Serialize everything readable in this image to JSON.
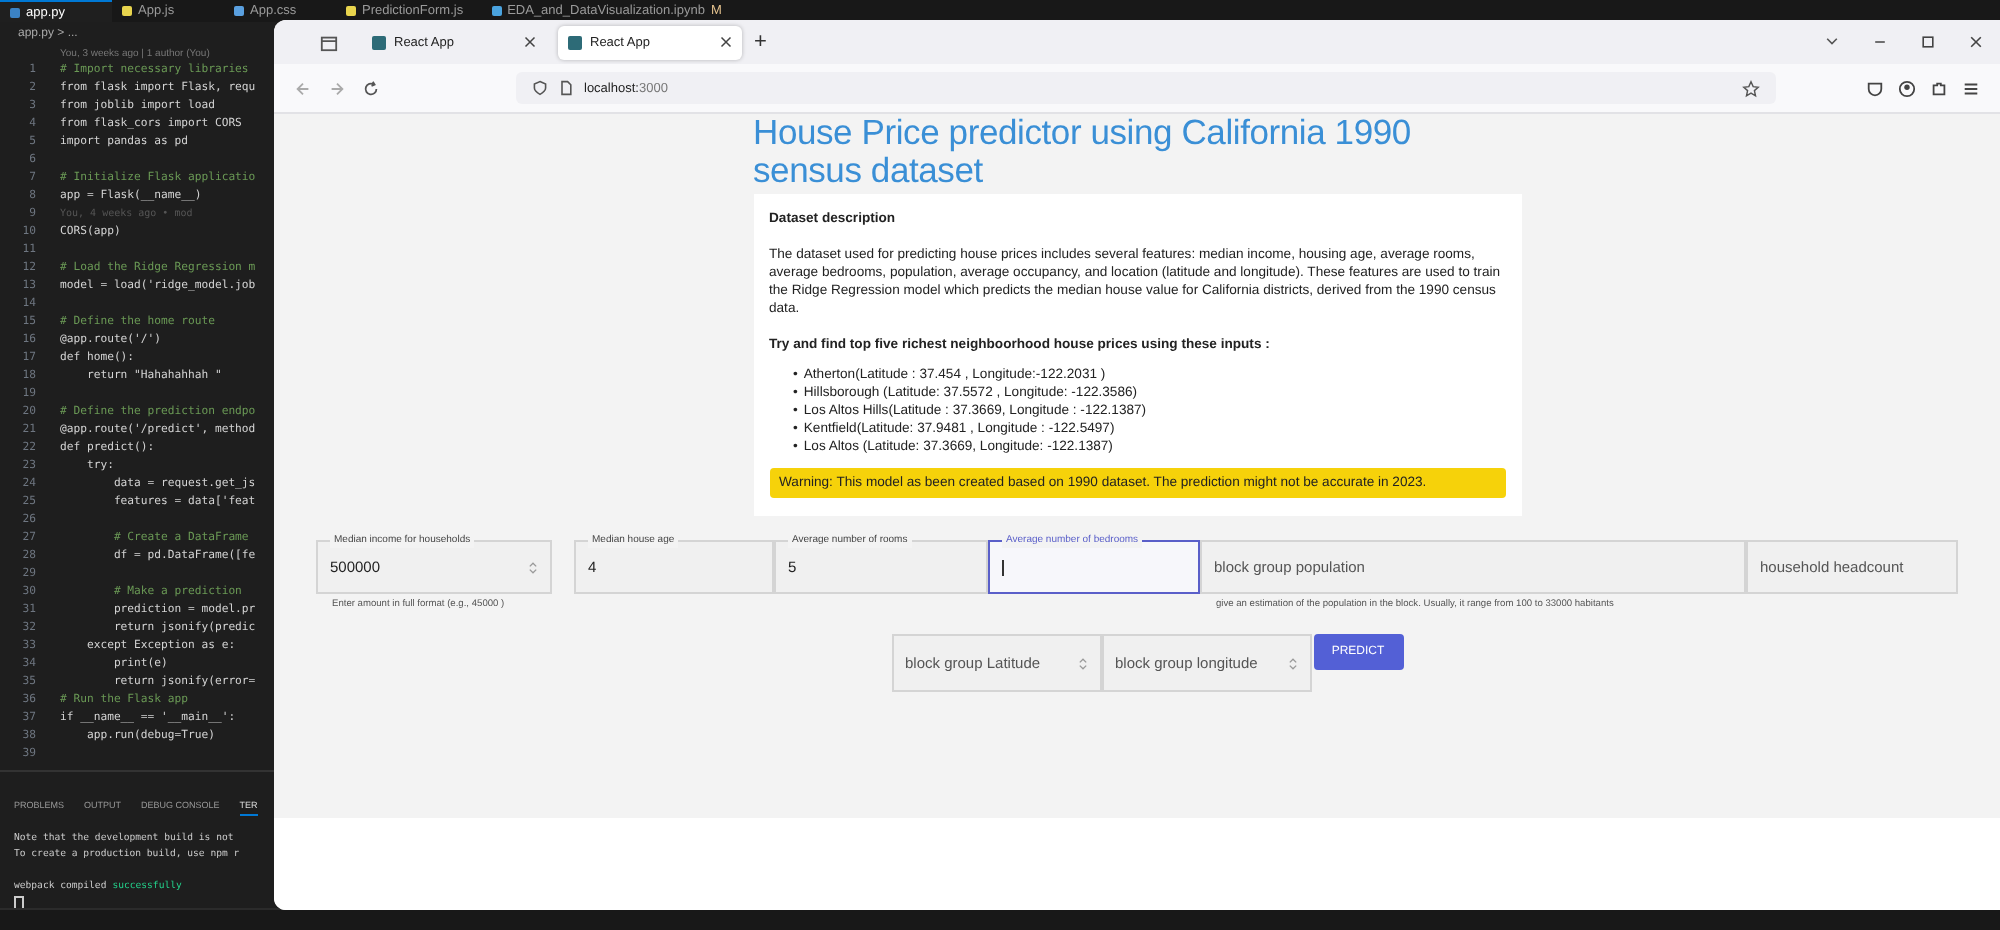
{
  "editor": {
    "tabs": [
      {
        "label": "app.py",
        "kind": "python",
        "selected": true
      },
      {
        "label": "App.js",
        "kind": "js",
        "selected": false
      },
      {
        "label": "App.css",
        "kind": "css",
        "selected": false
      },
      {
        "label": "PredictionForm.js",
        "kind": "js",
        "selected": false
      },
      {
        "label": "EDA_and_DataVisualization.ipynb",
        "kind": "notebook",
        "selected": false,
        "badge": "M"
      }
    ],
    "breadcrumb": "app.py > ...",
    "blame": "You, 3 weeks ago | 1 author (You)",
    "lines": [
      {
        "n": "1",
        "kind": "comment",
        "text": "# Import necessary libraries"
      },
      {
        "n": "2",
        "kind": "code",
        "text": "from flask import Flask, requ"
      },
      {
        "n": "3",
        "kind": "code",
        "text": "from joblib import load"
      },
      {
        "n": "4",
        "kind": "code",
        "text": "from flask_cors import CORS"
      },
      {
        "n": "5",
        "kind": "code",
        "text": "import pandas as pd"
      },
      {
        "n": "6"
      },
      {
        "n": "7",
        "kind": "comment",
        "text": "# Initialize Flask applicatio"
      },
      {
        "n": "8",
        "kind": "code",
        "text": "app = Flask(__name__)"
      },
      {
        "n": "9",
        "kind": "blame",
        "text": "You, 4 weeks ago • mod"
      },
      {
        "n": "10",
        "kind": "code",
        "text": "CORS(app)"
      },
      {
        "n": "11"
      },
      {
        "n": "12",
        "kind": "comment",
        "text": "# Load the Ridge Regression m"
      },
      {
        "n": "13",
        "kind": "code",
        "text": "model = load('ridge_model.job"
      },
      {
        "n": "14"
      },
      {
        "n": "15",
        "kind": "comment",
        "text": "# Define the home route"
      },
      {
        "n": "16",
        "kind": "code",
        "text": "@app.route('/')"
      },
      {
        "n": "17",
        "kind": "code",
        "text": "def home():"
      },
      {
        "n": "18",
        "kind": "code",
        "text": "    return \"Hahahahhah \""
      },
      {
        "n": "19"
      },
      {
        "n": "20",
        "kind": "comment",
        "text": "# Define the prediction endpo"
      },
      {
        "n": "21",
        "kind": "code",
        "text": "@app.route('/predict', method"
      },
      {
        "n": "22",
        "kind": "code",
        "text": "def predict():"
      },
      {
        "n": "23",
        "kind": "code",
        "text": "    try:"
      },
      {
        "n": "24",
        "kind": "code",
        "text": "        data = request.get_js"
      },
      {
        "n": "25",
        "kind": "code",
        "text": "        features = data['feat"
      },
      {
        "n": "26"
      },
      {
        "n": "27",
        "kind": "comment",
        "text": "        # Create a DataFrame"
      },
      {
        "n": "28",
        "kind": "code",
        "text": "        df = pd.DataFrame([fe"
      },
      {
        "n": "29"
      },
      {
        "n": "30",
        "kind": "comment",
        "text": "        # Make a prediction"
      },
      {
        "n": "31",
        "kind": "code",
        "text": "        prediction = model.pr"
      },
      {
        "n": "32",
        "kind": "code",
        "text": "        return jsonify(predic"
      },
      {
        "n": "33",
        "kind": "code",
        "text": "    except Exception as e:"
      },
      {
        "n": "34",
        "kind": "code",
        "text": "        print(e)"
      },
      {
        "n": "35",
        "kind": "code",
        "text": "        return jsonify(error="
      },
      {
        "n": "36",
        "kind": "comment",
        "text": "# Run the Flask app"
      },
      {
        "n": "37",
        "kind": "code",
        "text": "if __name__ == '__main__':"
      },
      {
        "n": "38",
        "kind": "code",
        "text": "    app.run(debug=True)"
      },
      {
        "n": "39"
      }
    ],
    "panel_tabs": [
      {
        "label": "PROBLEMS",
        "selected": false
      },
      {
        "label": "OUTPUT",
        "selected": false
      },
      {
        "label": "DEBUG CONSOLE",
        "selected": false
      },
      {
        "label": "TER",
        "selected": true
      }
    ],
    "terminal": [
      {
        "kind": "plain",
        "text": "Note that the development build is not"
      },
      {
        "kind": "plain",
        "text": "To create a production build, use npm r"
      },
      {
        "kind": "success",
        "text": "webpack compiled",
        "highlight": "successfully"
      }
    ]
  },
  "browser": {
    "tabs": [
      {
        "label": "React App",
        "selected": false
      },
      {
        "label": "React App",
        "selected": true
      }
    ],
    "new_tab": "+",
    "url_host": "localhost:",
    "url_port": "3000"
  },
  "page": {
    "title": "House Price predictor using California 1990 sensus dataset",
    "card": {
      "heading": "Dataset description",
      "description": "The dataset used for predicting house prices includes several features: median income, housing age, average rooms, average bedrooms, population, average occupancy, and location (latitude and longitude). These features are used to train the Ridge Regression model which predicts the median house value for California districts, derived from the 1990 census data.",
      "prompt": "Try and find top five richest neighboorhood house prices using these inputs :",
      "places": [
        {
          "marker": "•",
          "text": "Atherton(Latitude : 37.454 , Longitude:-122.2031 )"
        },
        {
          "marker": "•",
          "text": "Hillsborough (Latitude: 37.5572 , Longitude: -122.3586)"
        },
        {
          "marker": "•",
          "text": "Los Altos Hills(Latitude : 37.3669, Longitude : -122.1387)"
        },
        {
          "marker": "•",
          "text": "Kentfield(Latitude: 37.9481 , Longitude : -122.5497)"
        },
        {
          "marker": "•",
          "text": "Los Altos (Latitude: 37.3669, Longitude: -122.1387)"
        }
      ],
      "warning": "Warning: This model as been created based on 1990 dataset. The prediction might not be accurate in 2023."
    },
    "fields": [
      {
        "label": "Median income for households",
        "value": "500000",
        "spinner": true,
        "focused": false,
        "helper": "Enter amount in full format (e.g., 45000 )"
      },
      {
        "label": "Median house age",
        "value": "4",
        "spinner": false,
        "focused": false
      },
      {
        "label": "Average number of rooms",
        "value": "5",
        "spinner": false,
        "focused": false
      },
      {
        "label": "Average number of bedrooms",
        "spinner": false,
        "focused": true
      },
      {
        "placeholder": "block group population",
        "spinner": false,
        "focused": false,
        "helper": "give an estimation of the population in the block. Usually, it range from 100 to 33000 habitants"
      },
      {
        "placeholder": "household headcount",
        "spinner": false,
        "focused": false
      }
    ],
    "fields_row2": [
      {
        "placeholder": "block group Latitude",
        "spinner": true,
        "focused": false
      },
      {
        "placeholder": "block group longitude",
        "spinner": true,
        "focused": false
      }
    ],
    "predict_button": "PREDICT"
  }
}
